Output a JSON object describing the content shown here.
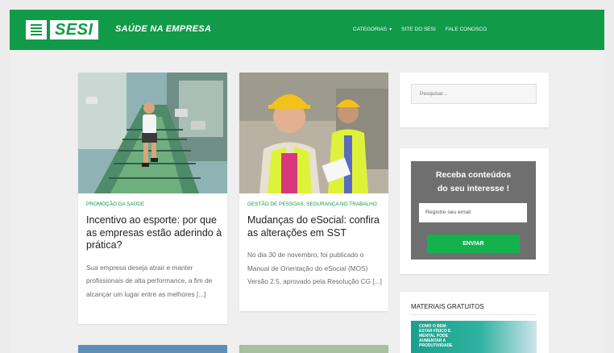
{
  "brand": {
    "logo_text": "SESI",
    "tagline": "SAÚDE NA EMPRESA"
  },
  "nav": [
    {
      "label": "CATEGORIAS",
      "has_caret": true
    },
    {
      "label": "SITE DO SESI"
    },
    {
      "label": "FALE CONOSCO"
    }
  ],
  "posts": [
    {
      "category": "PROMOÇÃO DA SAÚDE",
      "title": "Incentivo ao esporte: por que as empresas estão aderindo à prática?",
      "excerpt": "Sua empresa deseja atrair e manter profissionais de alta performance, a fim de alcançar um lugar entre as melhores [...]"
    },
    {
      "category": "GESTÃO DE PESSOAS, SEGURANÇA NO TRABALHO",
      "title": "Mudanças do eSocial: confira as alterações em SST",
      "excerpt": "No dia 30 de novembro, foi publicado o Manual de Orientação do eSocial (MOS) Versão 2.5, aprovado pela Resolução CG [...]"
    }
  ],
  "search": {
    "placeholder": "Pesquisar..."
  },
  "newsletter": {
    "title_line1": "Receba conteúdos",
    "title_line2": "do seu interesse !",
    "email_placeholder": "Registre seu email",
    "button": "ENVIAR"
  },
  "materials": {
    "heading": "MATERIAIS GRATUITOS",
    "item_text": "COMO O BEM-ESTAR FÍSICO E MENTAL PODE AUMENTAR A PRODUTIVIDADE"
  },
  "colors": {
    "brand_green": "#119a48",
    "button_green": "#14b14e",
    "newsletter_bg": "#6f6f6f"
  }
}
